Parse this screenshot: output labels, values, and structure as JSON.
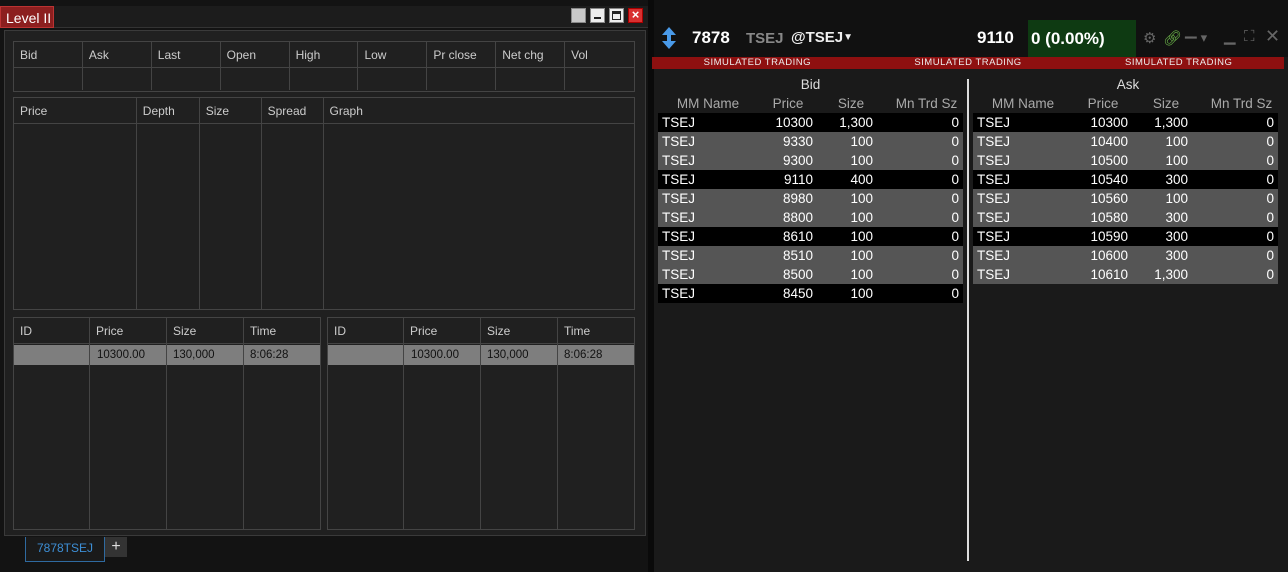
{
  "level2": {
    "title": "Level II",
    "quote_headers": [
      "Bid",
      "Ask",
      "Last",
      "Open",
      "High",
      "Low",
      "Pr close",
      "Net chg",
      "Vol"
    ],
    "depth_headers": [
      "Price",
      "Depth",
      "Size",
      "Spread",
      "Graph"
    ],
    "ts_headers": [
      "ID",
      "Price",
      "Size",
      "Time"
    ],
    "ts_left": {
      "id": "",
      "price": "10300.00",
      "size": "130,000",
      "time": "8:06:28"
    },
    "ts_right": {
      "id": "",
      "price": "10300.00",
      "size": "130,000",
      "time": "8:06:28"
    },
    "tab_label": "7878TSEJ",
    "tab_add": "+"
  },
  "book": {
    "symbol": "7878",
    "exchange": "TSEJ",
    "route": "@TSEJ",
    "last": "9110",
    "change": "0 (0.00%)",
    "sim_banner": [
      "SIMULATED TRADING",
      "SIMULATED TRADING",
      "SIMULATED TRADING"
    ],
    "bid_title": "Bid",
    "ask_title": "Ask",
    "col_headers": [
      "MM Name",
      "Price",
      "Size",
      "Mn Trd Sz"
    ],
    "bids": [
      {
        "mm": "TSEJ",
        "price": "10300",
        "size": "1,300",
        "mn": "0"
      },
      {
        "mm": "TSEJ",
        "price": "9330",
        "size": "100",
        "mn": "0"
      },
      {
        "mm": "TSEJ",
        "price": "9300",
        "size": "100",
        "mn": "0"
      },
      {
        "mm": "TSEJ",
        "price": "9110",
        "size": "400",
        "mn": "0"
      },
      {
        "mm": "TSEJ",
        "price": "8980",
        "size": "100",
        "mn": "0"
      },
      {
        "mm": "TSEJ",
        "price": "8800",
        "size": "100",
        "mn": "0"
      },
      {
        "mm": "TSEJ",
        "price": "8610",
        "size": "100",
        "mn": "0"
      },
      {
        "mm": "TSEJ",
        "price": "8510",
        "size": "100",
        "mn": "0"
      },
      {
        "mm": "TSEJ",
        "price": "8500",
        "size": "100",
        "mn": "0"
      },
      {
        "mm": "TSEJ",
        "price": "8450",
        "size": "100",
        "mn": "0"
      }
    ],
    "asks": [
      {
        "mm": "TSEJ",
        "price": "10300",
        "size": "1,300",
        "mn": "0"
      },
      {
        "mm": "TSEJ",
        "price": "10400",
        "size": "100",
        "mn": "0"
      },
      {
        "mm": "TSEJ",
        "price": "10500",
        "size": "100",
        "mn": "0"
      },
      {
        "mm": "TSEJ",
        "price": "10540",
        "size": "300",
        "mn": "0"
      },
      {
        "mm": "TSEJ",
        "price": "10560",
        "size": "100",
        "mn": "0"
      },
      {
        "mm": "TSEJ",
        "price": "10580",
        "size": "300",
        "mn": "0"
      },
      {
        "mm": "TSEJ",
        "price": "10590",
        "size": "300",
        "mn": "0"
      },
      {
        "mm": "TSEJ",
        "price": "10600",
        "size": "300",
        "mn": "0"
      },
      {
        "mm": "TSEJ",
        "price": "10610",
        "size": "1,300",
        "mn": "0"
      }
    ],
    "row_shades": [
      "b",
      "g",
      "g",
      "b",
      "g",
      "g",
      "b",
      "g",
      "g",
      "b"
    ],
    "colors": {
      "banner": "#8e1010",
      "change_bg": "#0e3a12",
      "accent_tab": "#3d8fd6"
    },
    "icons": [
      "up-down-arrow-icon",
      "dropdown-caret-icon",
      "gear-icon",
      "link-icon",
      "pin-icon",
      "minimize-icon",
      "expand-icon",
      "close-icon"
    ]
  }
}
